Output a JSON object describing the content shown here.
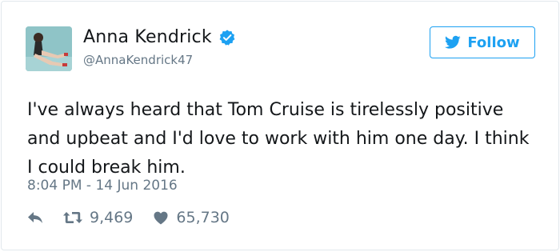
{
  "user": {
    "name": "Anna Kendrick",
    "handle": "@AnnaKendrick47",
    "verified": true
  },
  "follow_button": {
    "label": "Follow"
  },
  "tweet": {
    "text": "I've always heard that Tom Cruise is tirelessly positive and upbeat and I'd love to work with him one day. I think I could break him.",
    "timestamp": "8:04 PM - 14 Jun 2016"
  },
  "actions": {
    "retweets": "9,469",
    "likes": "65,730"
  },
  "colors": {
    "accent": "#1da1f2",
    "muted": "#657786",
    "text": "#14171a",
    "border": "#e1e8ed"
  },
  "icons": [
    "twitter-bird-icon",
    "verified-badge-icon",
    "reply-icon",
    "retweet-icon",
    "heart-icon"
  ]
}
